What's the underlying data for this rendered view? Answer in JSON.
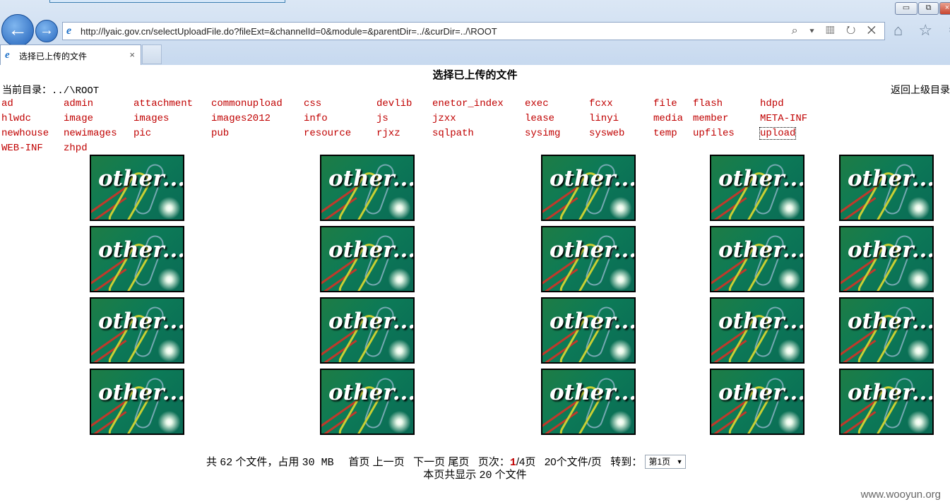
{
  "browser": {
    "url": "http://lyaic.gov.cn/selectUploadFile.do?fileExt=&channelId=0&module=&parentDir=../&curDir=../\\ROOT",
    "tab_title": "选择已上传的文件",
    "tab_close": "×",
    "window_buttons": {
      "minimize": "▭",
      "restore": "⧉",
      "close": "×"
    },
    "nav": {
      "back_icon": "←",
      "forward_icon": "→"
    },
    "address_icons": "⌕ ▾ ▦ ↻ ✕",
    "toolbar_icons": "⌂ ☆ ⚙"
  },
  "page": {
    "title": "选择已上传的文件",
    "current_dir_label": "当前目录：",
    "current_dir": "../\\ROOT",
    "back_up_label": "返回上级目录"
  },
  "directories": [
    "ad",
    "admin",
    "attachment",
    "commonupload",
    "css",
    "devlib",
    "enetor_index",
    "exec",
    "fcxx",
    "file",
    "flash",
    "hdpd",
    "hlwdc",
    "image",
    "images",
    "images2012",
    "info",
    "js",
    "jzxx",
    "lease",
    "linyi",
    "media",
    "member",
    "META-INF",
    "newhouse",
    "newimages",
    "pic",
    "pub",
    "resource",
    "rjxz",
    "sqlpath",
    "sysimg",
    "sysweb",
    "temp",
    "upfiles",
    "upload",
    "WEB-INF",
    "zhpd"
  ],
  "thumbnails": {
    "label": "other...",
    "count": 20
  },
  "pagination": {
    "total_prefix": "共",
    "total_files": "62",
    "total_mid": "个文件，占用",
    "total_size": "30 MB",
    "first": "首页",
    "prev": "上一页",
    "next": "下一页",
    "last": "尾页",
    "page_label": "页次：",
    "current_page": "1",
    "page_total": "/4页",
    "per_page": "20个文件/页",
    "goto_label": "转到：",
    "goto_selected": "第1页",
    "this_page_prefix": "本页共显示",
    "this_page_count": "20",
    "this_page_suffix": "个文件"
  },
  "watermark": "www.wooyun.org"
}
